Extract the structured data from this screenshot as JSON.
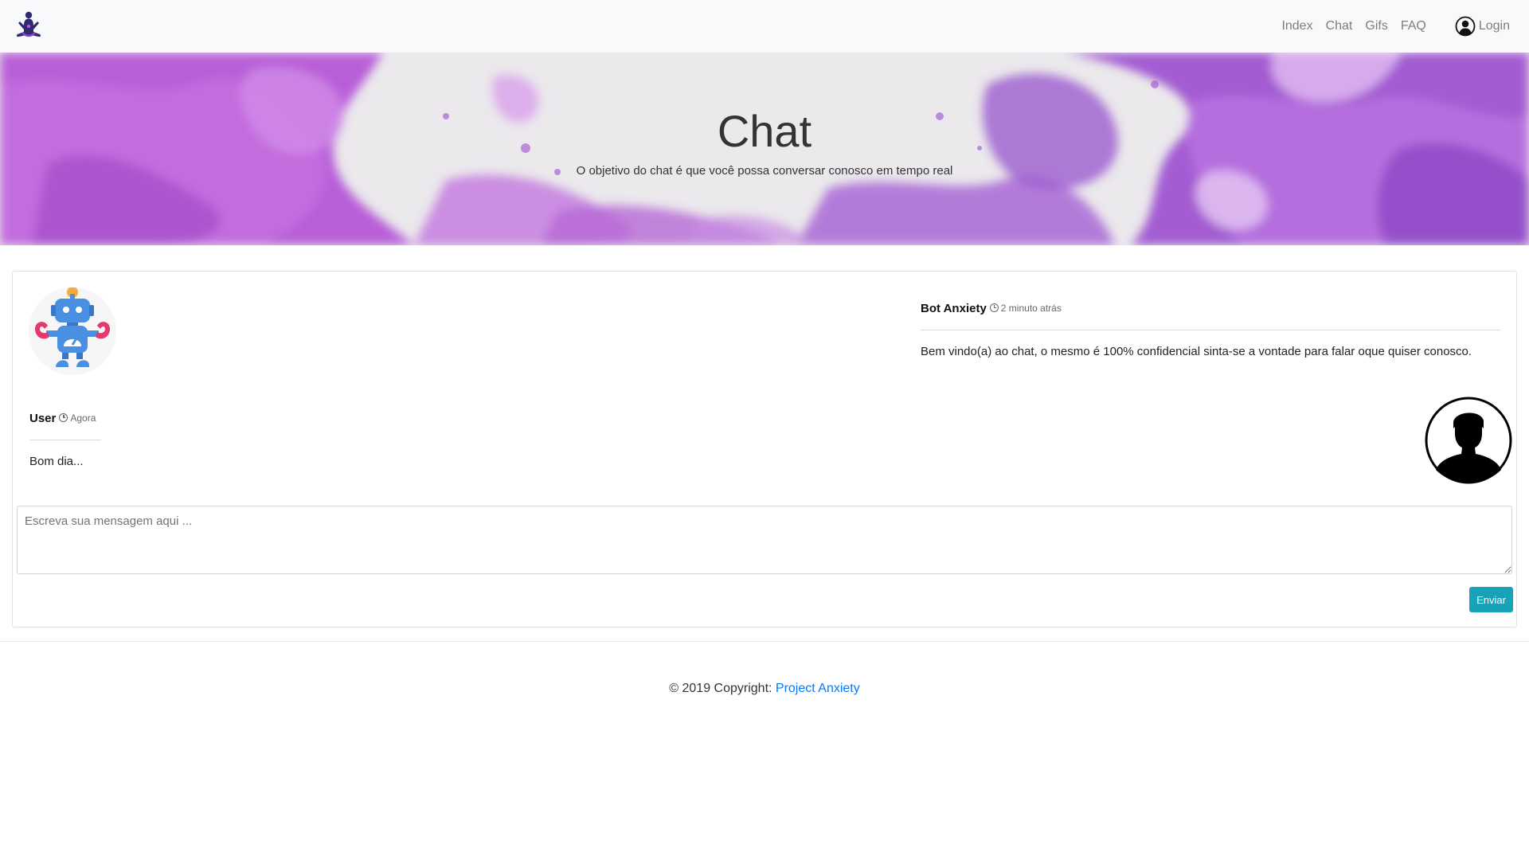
{
  "navbar": {
    "brand_icon": "meditation-logo-icon",
    "links": [
      {
        "label": "Index"
      },
      {
        "label": "Chat"
      },
      {
        "label": "Gifs"
      },
      {
        "label": "FAQ"
      }
    ],
    "login_label": "Login",
    "login_icon": "user-circle-icon"
  },
  "hero": {
    "title": "Chat",
    "subtitle": "O objetivo do chat é que você possa conversar conosco em tempo real",
    "accent_color": "#b05cd6"
  },
  "chat": {
    "bot": {
      "name": "Bot Anxiety",
      "time": "2 minuto atrás",
      "message": "Bem vindo(a) ao chat, o mesmo é 100% confidencial sinta-se a vontade para falar oque quiser conosco.",
      "avatar_icon": "robot-icon"
    },
    "user": {
      "name": "User",
      "time": "Agora",
      "message": "Bom dia...",
      "avatar_icon": "user-silhouette-icon"
    },
    "input_placeholder": "Escreva sua mensagem aqui ...",
    "send_label": "Enviar",
    "send_color": "#17a2b8"
  },
  "footer": {
    "prefix": "© 2019 Copyright: ",
    "link_label": "Project Anxiety",
    "link_color": "#007bff"
  }
}
